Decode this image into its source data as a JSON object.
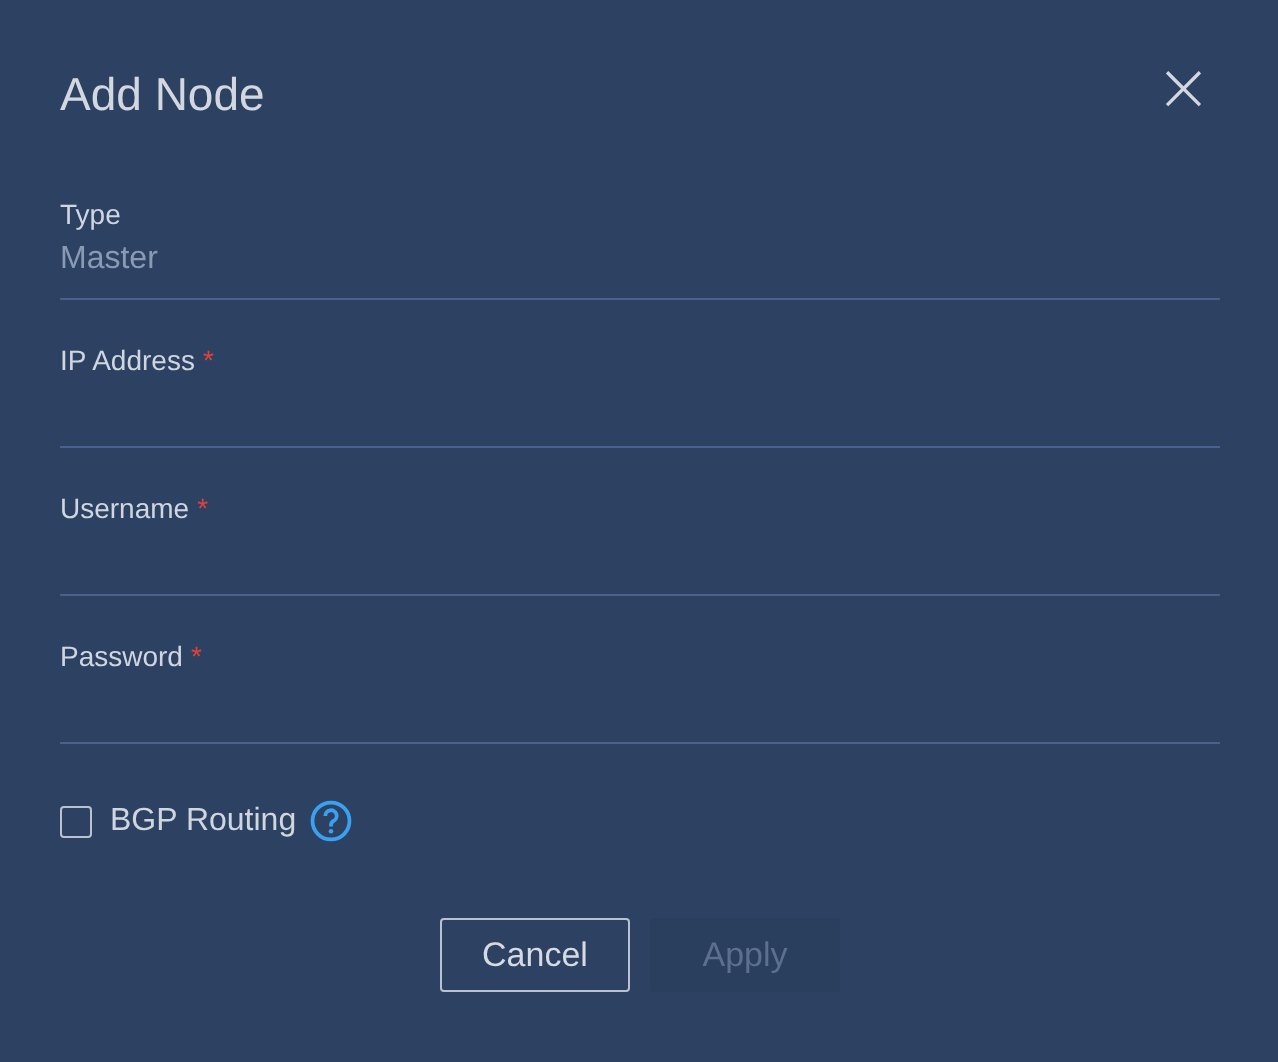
{
  "dialog": {
    "title": "Add Node",
    "close_icon": "×"
  },
  "fields": [
    {
      "kind": "static",
      "label": "Type",
      "value": "Master"
    },
    {
      "kind": "input",
      "label": "IP Address",
      "required_mark": "*"
    },
    {
      "kind": "input",
      "label": "Username",
      "required_mark": "*"
    },
    {
      "kind": "password",
      "label": "Password",
      "required_mark": "*"
    }
  ],
  "bgp_routing": {
    "label": "BGP Routing",
    "checked": false
  },
  "buttons": [
    {
      "label": "Cancel",
      "disabled": false
    },
    {
      "label": "Apply",
      "disabled": true
    }
  ]
}
